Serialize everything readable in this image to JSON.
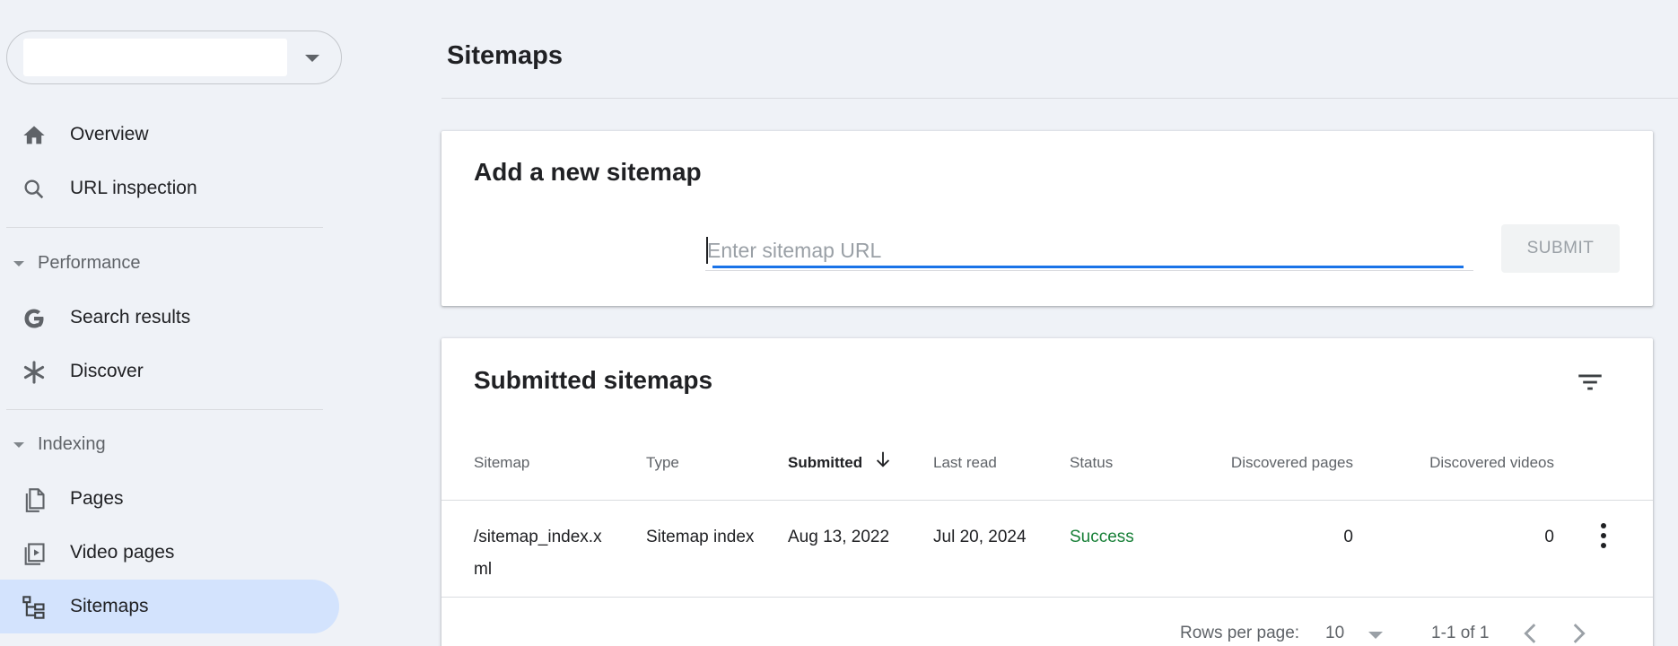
{
  "sidebar": {
    "property_picker": {
      "value": ""
    },
    "items": [
      {
        "label": "Overview",
        "icon": "home-icon"
      },
      {
        "label": "URL inspection",
        "icon": "search-icon"
      },
      {
        "label": "Search results",
        "icon": "google-g-icon"
      },
      {
        "label": "Discover",
        "icon": "asterisk-icon"
      },
      {
        "label": "Pages",
        "icon": "pages-icon"
      },
      {
        "label": "Video pages",
        "icon": "video-pages-icon"
      },
      {
        "label": "Sitemaps",
        "icon": "sitemap-icon",
        "active": true
      }
    ],
    "sections": [
      {
        "label": "Performance"
      },
      {
        "label": "Indexing"
      }
    ]
  },
  "main": {
    "title": "Sitemaps",
    "add_card": {
      "title": "Add a new sitemap",
      "input": {
        "placeholder": "Enter sitemap URL",
        "value": ""
      },
      "submit_label": "SUBMIT"
    },
    "list_card": {
      "title": "Submitted sitemaps",
      "columns": [
        "Sitemap",
        "Type",
        "Submitted",
        "Last read",
        "Status",
        "Discovered pages",
        "Discovered videos"
      ],
      "sorted_column": "Submitted",
      "rows": [
        {
          "sitemap_line1": "/sitemap_index.x",
          "sitemap_line2": "ml",
          "type": "Sitemap index",
          "submitted": "Aug 13, 2022",
          "last_read": "Jul 20, 2024",
          "status": "Success",
          "discovered_pages": "0",
          "discovered_videos": "0"
        }
      ],
      "footer": {
        "rows_per_page_label": "Rows per page:",
        "rows_per_page_value": "10",
        "range": "1-1 of 1"
      }
    }
  },
  "colors": {
    "accent": "#1a73e8",
    "active_nav": "#d3e3fd",
    "success": "#188038",
    "background": "#eff2f7"
  }
}
